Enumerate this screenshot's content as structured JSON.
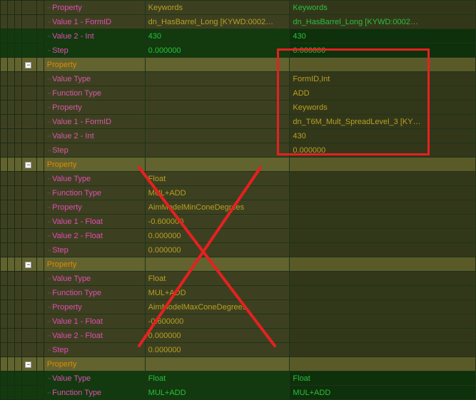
{
  "labels": {
    "property": "Property",
    "value_type": "Value Type",
    "function_type": "Function Type",
    "value1_formid": "Value 1 - FormID",
    "value2_int": "Value 2 - Int",
    "step": "Step",
    "value1_float": "Value 1 - Float",
    "value2_float": "Value 2 - Float"
  },
  "groups": [
    {
      "header": null,
      "rows": [
        {
          "label_key": "property",
          "indent": 3,
          "label_cls": "lbl-magenta",
          "v1": "Keywords",
          "v2": "Keywords",
          "v1_cls": "val-olive",
          "v2_cls": "val-green",
          "tone": "olive"
        },
        {
          "label_key": "value1_formid",
          "indent": 3,
          "label_cls": "lbl-magenta",
          "v1": "dn_HasBarrel_Long [KYWD:0002…",
          "v2": "dn_HasBarrel_Long [KYWD:0002…",
          "v1_cls": "val-olive",
          "v2_cls": "val-green",
          "tone": "olive"
        },
        {
          "label_key": "value2_int",
          "indent": 3,
          "label_cls": "lbl-magenta",
          "v1": "430",
          "v2": "430",
          "v1_cls": "val-green",
          "v2_cls": "val-green",
          "tone": "green"
        },
        {
          "label_key": "step",
          "indent": 3,
          "label_cls": "lbl-magenta",
          "v1": "0.000000",
          "v2": "0.000000",
          "v1_cls": "val-green",
          "v2_cls": "val-green",
          "tone": "green"
        }
      ]
    },
    {
      "header": {
        "label_key": "property",
        "label_cls": "lbl-orange"
      },
      "rows": [
        {
          "label_key": "value_type",
          "indent": 3,
          "label_cls": "lbl-magenta2",
          "v1": "",
          "v2": "FormID,Int",
          "v1_cls": "",
          "v2_cls": "val-olive",
          "tone": "olive"
        },
        {
          "label_key": "function_type",
          "indent": 3,
          "label_cls": "lbl-magenta2",
          "v1": "",
          "v2": "ADD",
          "v1_cls": "",
          "v2_cls": "val-olive",
          "tone": "olive"
        },
        {
          "label_key": "property",
          "indent": 3,
          "label_cls": "lbl-magenta2",
          "v1": "",
          "v2": "Keywords",
          "v1_cls": "",
          "v2_cls": "val-olive",
          "tone": "olive"
        },
        {
          "label_key": "value1_formid",
          "indent": 3,
          "label_cls": "lbl-magenta2",
          "v1": "",
          "v2": "dn_T6M_Mult_SpreadLevel_3 [KY…",
          "v1_cls": "",
          "v2_cls": "val-olive",
          "tone": "olive"
        },
        {
          "label_key": "value2_int",
          "indent": 3,
          "label_cls": "lbl-magenta2",
          "v1": "",
          "v2": "430",
          "v1_cls": "",
          "v2_cls": "val-olive",
          "tone": "olive"
        },
        {
          "label_key": "step",
          "indent": 3,
          "label_cls": "lbl-magenta2",
          "v1": "",
          "v2": "0.000000",
          "v1_cls": "",
          "v2_cls": "val-olive",
          "tone": "olive"
        }
      ]
    },
    {
      "header": {
        "label_key": "property",
        "label_cls": "lbl-orange"
      },
      "rows": [
        {
          "label_key": "value_type",
          "indent": 3,
          "label_cls": "lbl-magenta",
          "v1": "Float",
          "v2": "",
          "v1_cls": "val-olive",
          "v2_cls": "",
          "tone": "olive"
        },
        {
          "label_key": "function_type",
          "indent": 3,
          "label_cls": "lbl-magenta",
          "v1": "MUL+ADD",
          "v2": "",
          "v1_cls": "val-olive",
          "v2_cls": "",
          "tone": "olive"
        },
        {
          "label_key": "property",
          "indent": 3,
          "label_cls": "lbl-magenta",
          "v1": "AimModelMinConeDegrees",
          "v2": "",
          "v1_cls": "val-olive",
          "v2_cls": "",
          "tone": "olive"
        },
        {
          "label_key": "value1_float",
          "indent": 3,
          "label_cls": "lbl-magenta",
          "v1": "-0.600000",
          "v2": "",
          "v1_cls": "val-olive",
          "v2_cls": "",
          "tone": "olive"
        },
        {
          "label_key": "value2_float",
          "indent": 3,
          "label_cls": "lbl-magenta",
          "v1": "0.000000",
          "v2": "",
          "v1_cls": "val-olive",
          "v2_cls": "",
          "tone": "olive"
        },
        {
          "label_key": "step",
          "indent": 3,
          "label_cls": "lbl-magenta",
          "v1": "0.000000",
          "v2": "",
          "v1_cls": "val-olive",
          "v2_cls": "",
          "tone": "olive"
        }
      ]
    },
    {
      "header": {
        "label_key": "property",
        "label_cls": "lbl-orange"
      },
      "rows": [
        {
          "label_key": "value_type",
          "indent": 3,
          "label_cls": "lbl-magenta",
          "v1": "Float",
          "v2": "",
          "v1_cls": "val-olive",
          "v2_cls": "",
          "tone": "olive"
        },
        {
          "label_key": "function_type",
          "indent": 3,
          "label_cls": "lbl-magenta",
          "v1": "MUL+ADD",
          "v2": "",
          "v1_cls": "val-olive",
          "v2_cls": "",
          "tone": "olive"
        },
        {
          "label_key": "property",
          "indent": 3,
          "label_cls": "lbl-magenta",
          "v1": "AimModelMaxConeDegrees",
          "v2": "",
          "v1_cls": "val-olive",
          "v2_cls": "",
          "tone": "olive"
        },
        {
          "label_key": "value1_float",
          "indent": 3,
          "label_cls": "lbl-magenta",
          "v1": "-0.600000",
          "v2": "",
          "v1_cls": "val-olive",
          "v2_cls": "",
          "tone": "olive"
        },
        {
          "label_key": "value2_float",
          "indent": 3,
          "label_cls": "lbl-magenta",
          "v1": "0.000000",
          "v2": "",
          "v1_cls": "val-olive",
          "v2_cls": "",
          "tone": "olive"
        },
        {
          "label_key": "step",
          "indent": 3,
          "label_cls": "lbl-magenta",
          "v1": "0.000000",
          "v2": "",
          "v1_cls": "val-olive",
          "v2_cls": "",
          "tone": "olive"
        }
      ]
    },
    {
      "header": {
        "label_key": "property",
        "label_cls": "lbl-orange"
      },
      "rows": [
        {
          "label_key": "value_type",
          "indent": 3,
          "label_cls": "lbl-magenta",
          "v1": "Float",
          "v2": "Float",
          "v1_cls": "val-green",
          "v2_cls": "val-green",
          "tone": "green"
        },
        {
          "label_key": "function_type",
          "indent": 3,
          "label_cls": "lbl-magenta",
          "v1": "MUL+ADD",
          "v2": "MUL+ADD",
          "v1_cls": "val-green",
          "v2_cls": "val-green",
          "tone": "green"
        }
      ]
    }
  ],
  "expander_glyph": "−"
}
